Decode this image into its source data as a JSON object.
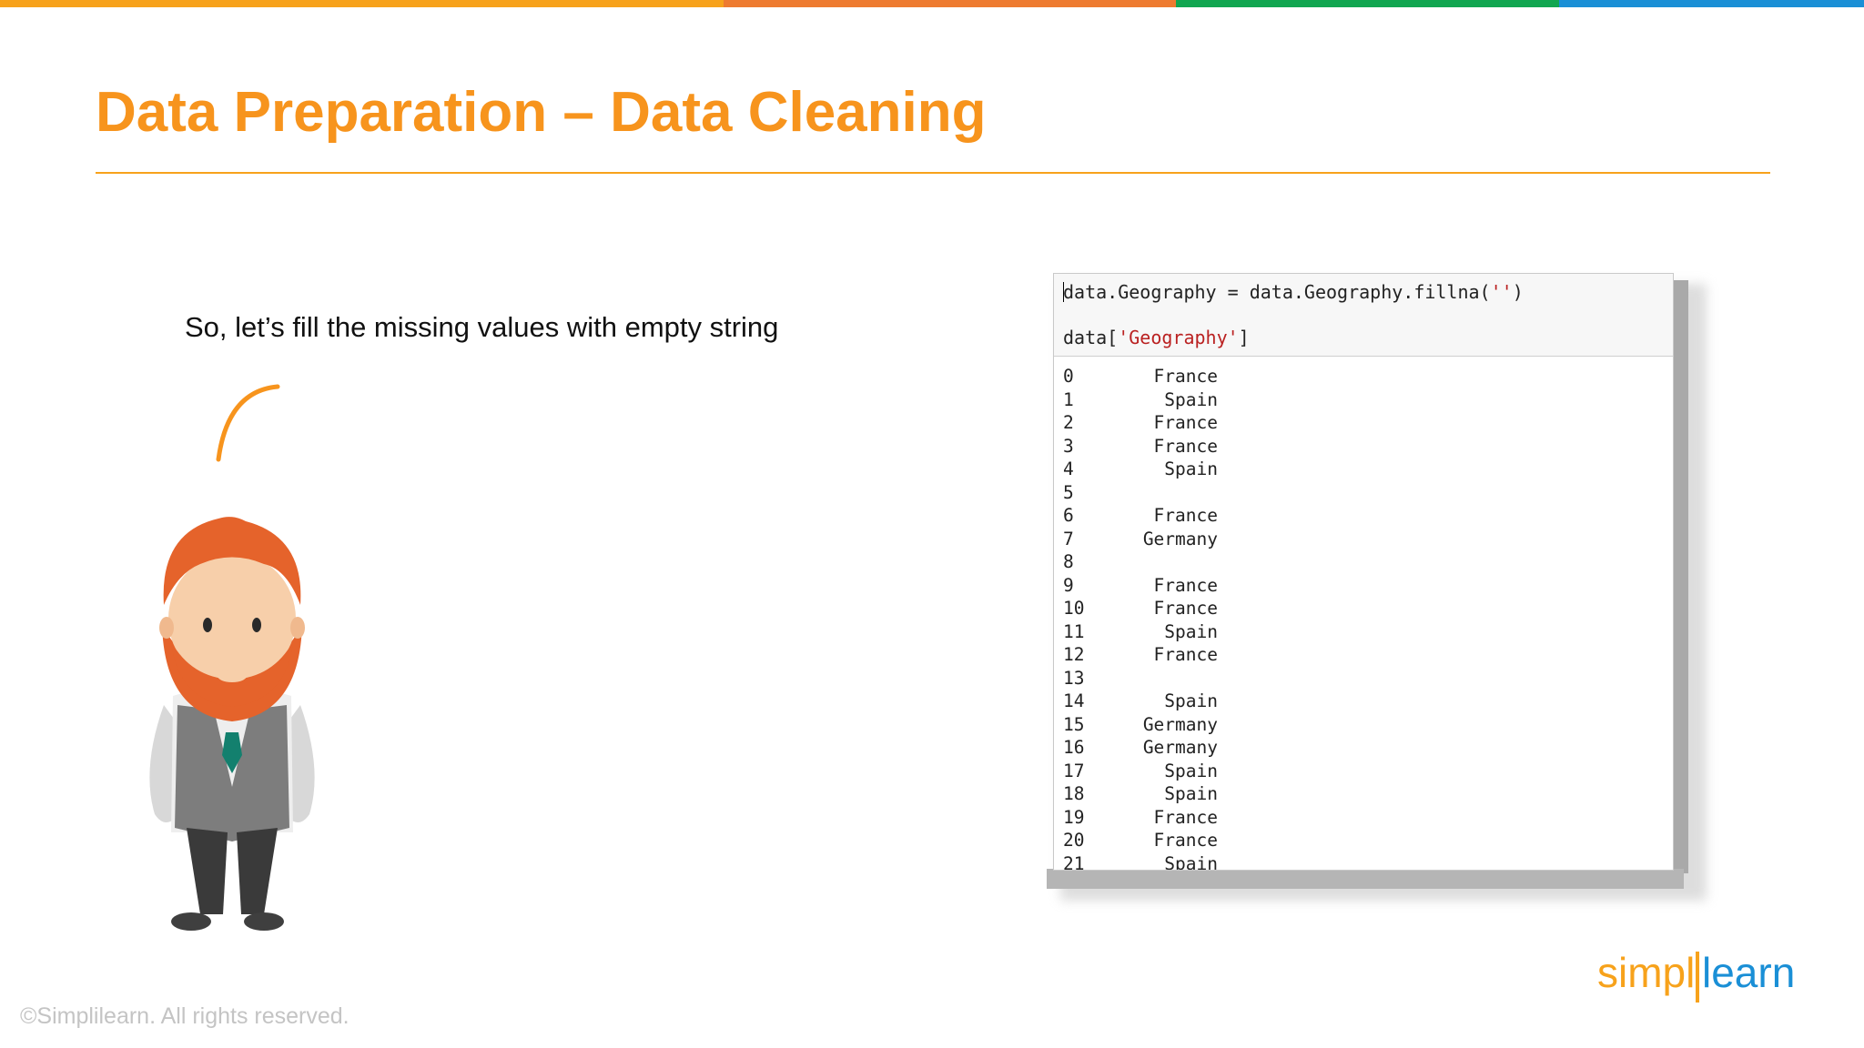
{
  "slide": {
    "title": "Data Preparation – Data Cleaning",
    "subtitle": "So, let’s fill the missing values with empty string",
    "footer": "©Simplilearn. All rights reserved.",
    "top_bar_colors": [
      "#f7a21b",
      "#ee7b30",
      "#11a650",
      "#1a8fd6"
    ]
  },
  "notebook": {
    "code_line_1_pre": "data.Geography = data.Geography.fillna(",
    "code_line_1_str": "''",
    "code_line_1_post": ")",
    "code_line_2_pre": "data[",
    "code_line_2_str": "'Geography'",
    "code_line_2_post": "]",
    "output_rows": [
      {
        "index": "0",
        "value": "France"
      },
      {
        "index": "1",
        "value": "Spain"
      },
      {
        "index": "2",
        "value": "France"
      },
      {
        "index": "3",
        "value": "France"
      },
      {
        "index": "4",
        "value": "Spain"
      },
      {
        "index": "5",
        "value": ""
      },
      {
        "index": "6",
        "value": "France"
      },
      {
        "index": "7",
        "value": "Germany"
      },
      {
        "index": "8",
        "value": ""
      },
      {
        "index": "9",
        "value": "France"
      },
      {
        "index": "10",
        "value": "France"
      },
      {
        "index": "11",
        "value": "Spain"
      },
      {
        "index": "12",
        "value": "France"
      },
      {
        "index": "13",
        "value": ""
      },
      {
        "index": "14",
        "value": "Spain"
      },
      {
        "index": "15",
        "value": "Germany"
      },
      {
        "index": "16",
        "value": "Germany"
      },
      {
        "index": "17",
        "value": "Spain"
      },
      {
        "index": "18",
        "value": "Spain"
      },
      {
        "index": "19",
        "value": "France"
      },
      {
        "index": "20",
        "value": "France"
      },
      {
        "index": "21",
        "value": "Spain"
      }
    ]
  },
  "logo": {
    "text_part1": "simpl",
    "text_part2": "learn",
    "color_dark": "#f7a21b",
    "color_blue": "#1a8fd6"
  },
  "icons": {
    "character": "bearded-man-illustration-icon",
    "speech": "speech-arc-icon"
  }
}
